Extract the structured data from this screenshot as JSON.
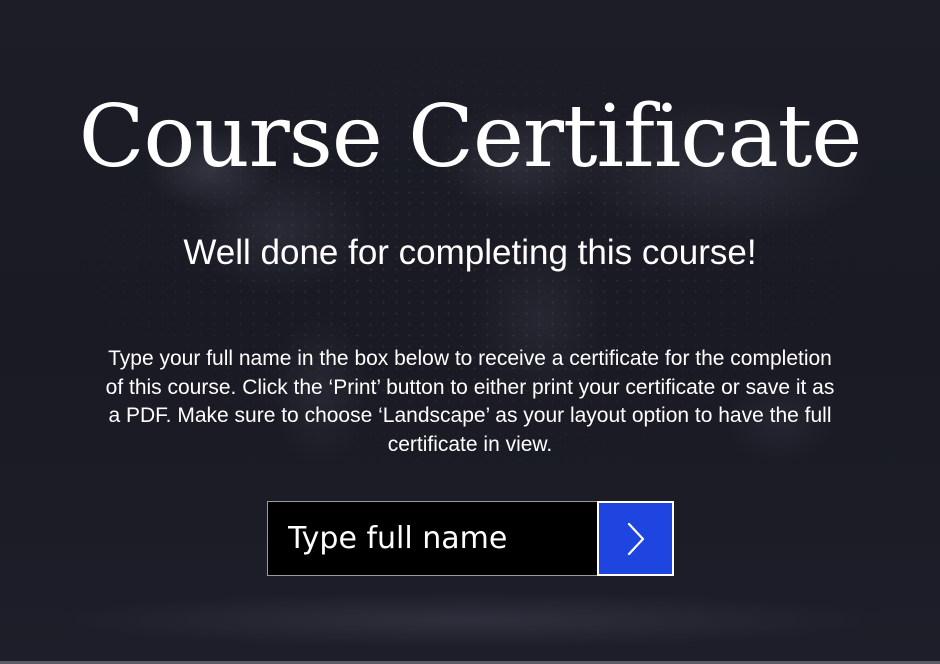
{
  "page": {
    "title": "Course Certificate",
    "subtitle": "Well done for completing this course!",
    "instructions": "Type your full name in the box below to receive a certificate for the completion of this course. Click the ‘Print’ button to either print your certificate or save it as a PDF. Make sure to choose ‘Landscape’ as your layout option to have the full certificate in view."
  },
  "form": {
    "name_placeholder": "Type full name",
    "name_value": "",
    "submit_icon": "chevron-right-icon"
  },
  "colors": {
    "background": "#1a1b24",
    "text": "#ffffff",
    "input_background": "#000000",
    "submit_button": "#1f45e0"
  }
}
